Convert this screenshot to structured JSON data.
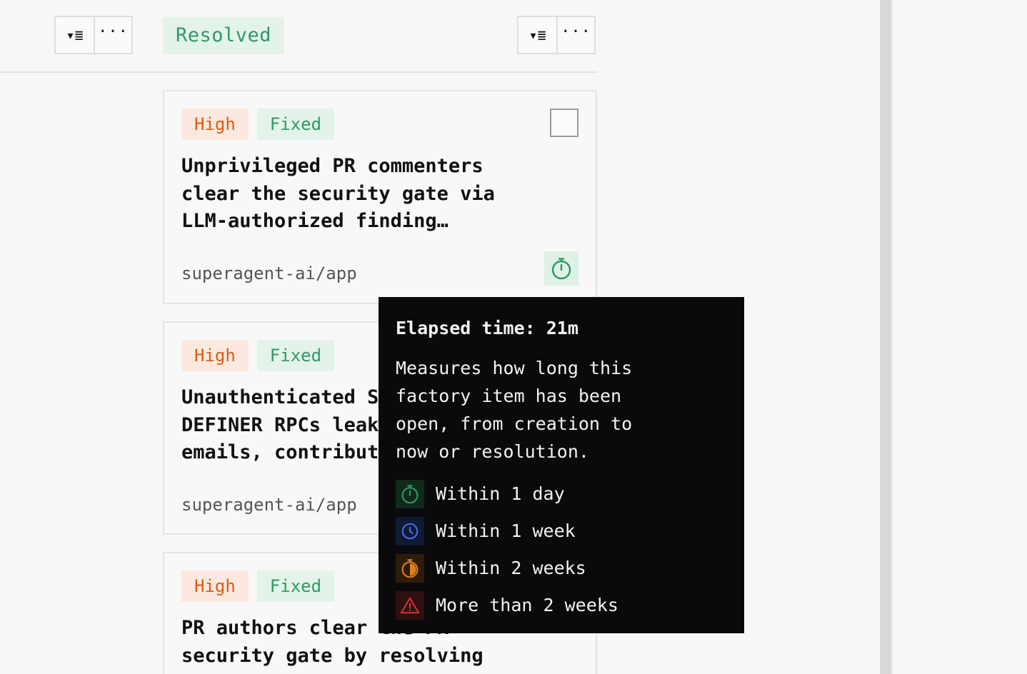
{
  "toolbar": {
    "left": {
      "sort_glyph": "▾≣",
      "more_glyph": "···"
    },
    "right": {
      "sort_glyph": "▾≣",
      "more_glyph": "···"
    }
  },
  "column": {
    "title": "Resolved"
  },
  "cards": [
    {
      "severity": "High",
      "status": "Fixed",
      "title": "Unprivileged PR commenters clear the security gate via LLM-authorized finding…",
      "repo": "superagent-ai/app"
    },
    {
      "severity": "High",
      "status": "Fixed",
      "title": "Unauthenticated S DEFINER RPCs leak emails, contribut",
      "repo": "superagent-ai/app"
    },
    {
      "severity": "High",
      "status": "Fixed",
      "title": "PR authors clear the PR security gate by resolving",
      "repo": ""
    }
  ],
  "tooltip": {
    "title": "Elapsed time: 21m",
    "body": "Measures how long this factory item has been open, from creation to now or resolution.",
    "legend": [
      {
        "label": "Within 1 day",
        "icon": "stopwatch-icon",
        "color": "#2f9a63",
        "bg": "#10291b"
      },
      {
        "label": "Within 1 week",
        "icon": "clock-icon",
        "color": "#4a6cf0",
        "bg": "#111a35"
      },
      {
        "label": "Within 2 weeks",
        "icon": "stopwatch-half-icon",
        "color": "#e0801a",
        "bg": "#2e1c0a"
      },
      {
        "label": "More than 2 weeks",
        "icon": "warning-triangle-icon",
        "color": "#d9322e",
        "bg": "#2e1010"
      }
    ]
  },
  "colors": {
    "fixed_green": "#2f9a63",
    "high_orange": "#dd5a12",
    "tooltip_bg": "#0a0a0c"
  }
}
